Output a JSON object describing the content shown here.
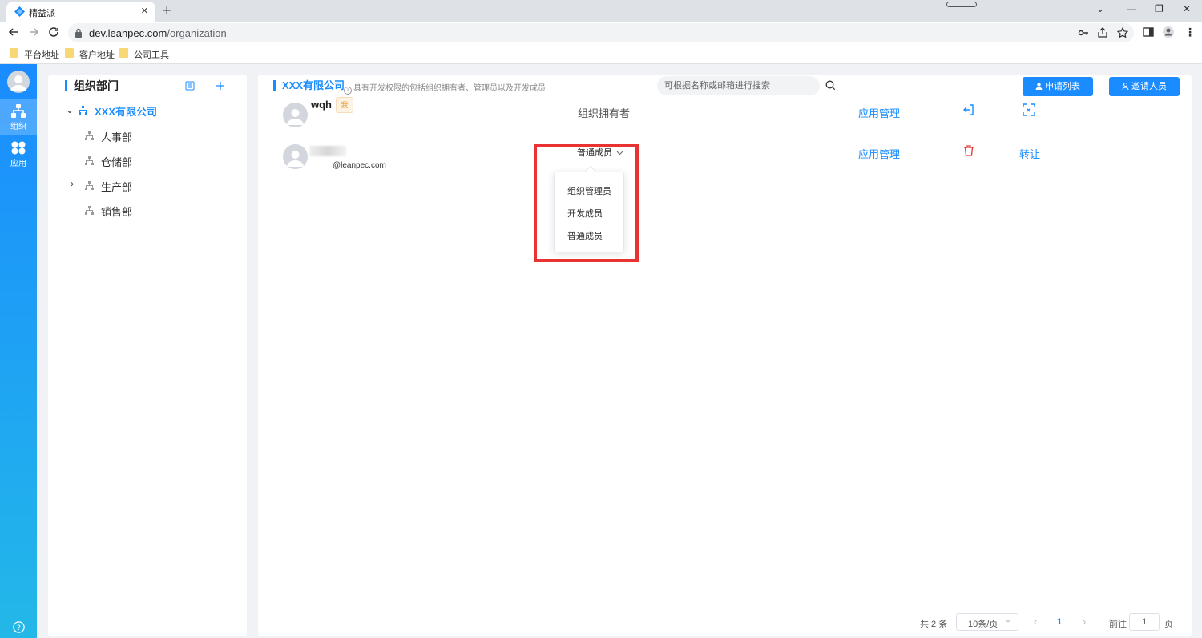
{
  "browser": {
    "tab_title": "精益派",
    "url_host": "dev.leanpec.com",
    "url_path": "/organization",
    "bookmarks": [
      "平台地址",
      "客户地址",
      "公司工具"
    ]
  },
  "sidebar": {
    "items": [
      {
        "label": "组织",
        "icon": "org-icon",
        "active": true
      },
      {
        "label": "应用",
        "icon": "apps-icon",
        "active": false
      }
    ]
  },
  "departments": {
    "title": "组织部门",
    "root": "XXX有限公司",
    "children": [
      "人事部",
      "仓储部",
      "生产部",
      "销售部"
    ]
  },
  "main": {
    "company": "XXX有限公司",
    "hint": "具有开发权限的包括组织拥有者、管理员以及开发成员",
    "search_placeholder": "可根据名称或邮箱进行搜索",
    "apply_list_label": "申请列表",
    "invite_label": "邀请人员"
  },
  "members": [
    {
      "name": "wqh",
      "badge": "我",
      "role": "组织拥有者",
      "app_link": "应用管理",
      "action_icon": "exit-icon",
      "extra_icon": "collapse-icon"
    },
    {
      "email": "@leanpec.com",
      "role": "普通成员",
      "app_link": "应用管理",
      "action_icon": "delete-icon",
      "transfer": "转让"
    }
  ],
  "role_dropdown": {
    "options": [
      "组织管理员",
      "开发成员",
      "普通成员"
    ]
  },
  "pagination": {
    "total": "共 2 条",
    "page_size": "10条/页",
    "current": "1",
    "goto_label": "前往",
    "goto_value": "1",
    "page_suffix": "页"
  },
  "colors": {
    "accent": "#1a8cff",
    "danger": "#e93333",
    "badge": "#e6a23c"
  }
}
